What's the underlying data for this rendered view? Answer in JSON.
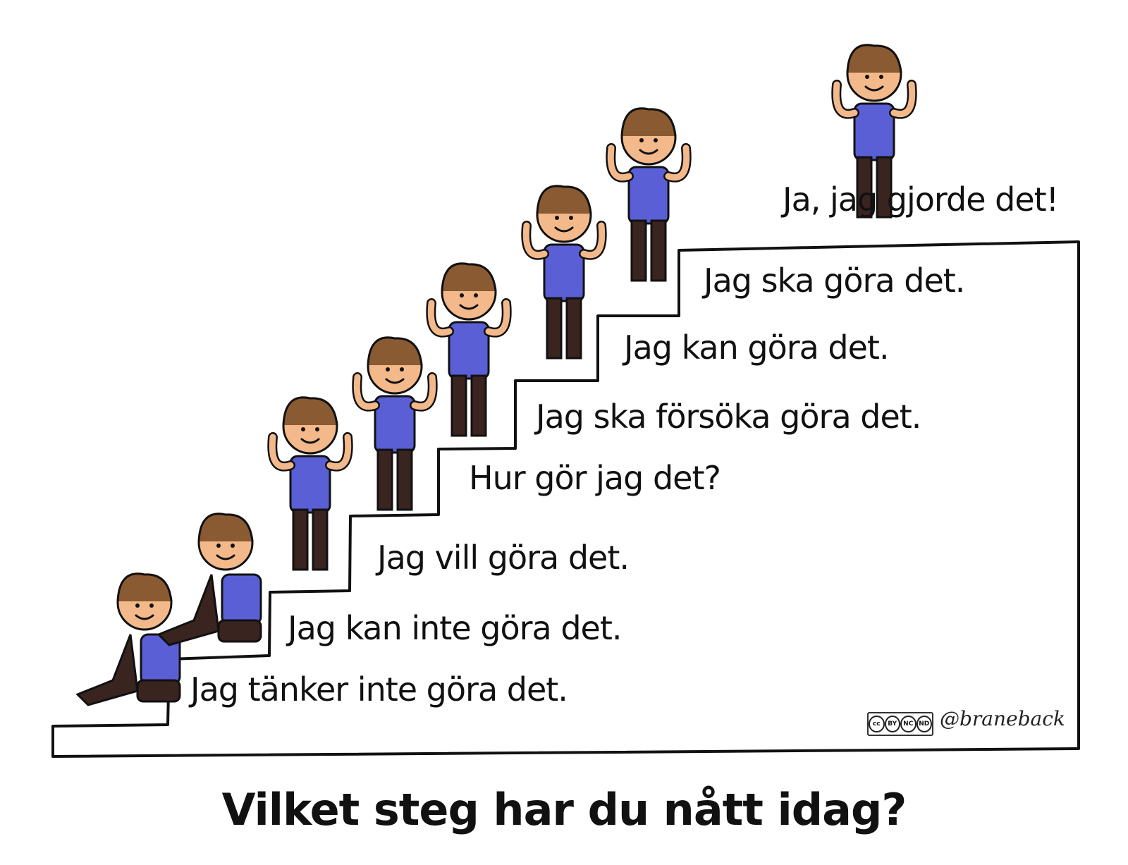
{
  "steps": [
    {
      "text": "Jag tänker inte göra det."
    },
    {
      "text": "Jag kan inte göra det."
    },
    {
      "text": "Jag vill göra det."
    },
    {
      "text": "Hur gör jag det?"
    },
    {
      "text": "Jag ska försöka göra det."
    },
    {
      "text": "Jag kan göra det."
    },
    {
      "text": "Jag ska göra det."
    },
    {
      "text": "Ja, jag gjorde det!"
    }
  ],
  "question": "Vilket steg har du nått idag?",
  "credit": "@braneback",
  "license": {
    "parts": [
      "cc",
      "BY",
      "NC",
      "ND"
    ]
  },
  "colors": {
    "shirt": "#5a5fd6",
    "pants": "#3a2420",
    "skin": "#f3b98a",
    "hair": "#8a5a32",
    "line": "#111111"
  }
}
